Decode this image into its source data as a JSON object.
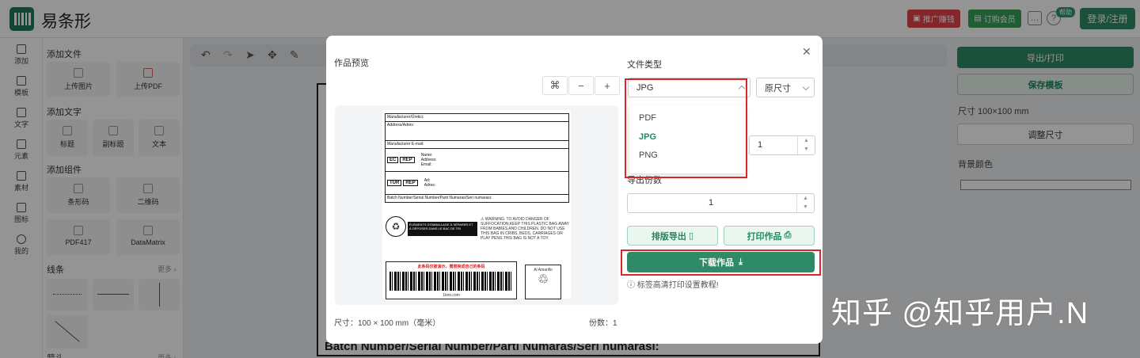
{
  "app": {
    "brand": "易条形"
  },
  "header": {
    "promo_label": "推广赚钱",
    "order_label": "订购会员",
    "help_badge": "帮助",
    "login_label": "登录/注册",
    "colors": {
      "promo": "#e0444a",
      "order": "#3aa05a",
      "login": "#2f8a67"
    }
  },
  "rail": {
    "items": [
      {
        "label": "添加",
        "icon": "plus-icon"
      },
      {
        "label": "模板",
        "icon": "grid-icon"
      },
      {
        "label": "文字",
        "icon": "text-icon"
      },
      {
        "label": "元素",
        "icon": "shapes-icon"
      },
      {
        "label": "素材",
        "icon": "assets-icon"
      },
      {
        "label": "图标",
        "icon": "icons-icon"
      },
      {
        "label": "我的",
        "icon": "user-icon"
      }
    ]
  },
  "panel": {
    "add_file": "添加文件",
    "upload_image": "上传图片",
    "upload_pdf": "上传PDF",
    "add_text": "添加文字",
    "title": "标题",
    "subtitle": "副标题",
    "text": "文本",
    "add_component": "添加组件",
    "barcode": "条形码",
    "qrcode": "二维码",
    "pdf417": "PDF417",
    "datamatrix": "DataMatrix",
    "lines": "线条",
    "more": "更多 ›",
    "arrows": "箭头"
  },
  "canvas": {
    "bottom_text": "Batch Number/Serial Number/Parti Numaras/Seri numarası:"
  },
  "right_panel": {
    "export_print": "导出/打印",
    "save_template": "保存模板",
    "size": "尺寸 100×100 mm",
    "resize": "调整尺寸",
    "bg_color": "背景颜色"
  },
  "modal": {
    "title": "作品预览",
    "close_icon": "close-icon",
    "zoom": {
      "fit": "⌘",
      "minus": "−",
      "plus": "+"
    },
    "file_type_label": "文件类型",
    "file_type_value": "JPG",
    "size_mode_value": "原尺寸",
    "file_type_options": [
      "PDF",
      "JPG",
      "PNG"
    ],
    "selected_option": "JPG",
    "dpi_value": "1",
    "copies_label": "导出份数",
    "copies_value": "1",
    "layout_export": "排版导出",
    "print_work": "打印作品",
    "download": "下载作品",
    "tip": "标签高清打印设置教程!",
    "footer_size": "尺寸：100 × 100 mm（毫米）",
    "footer_copies": "份数：1",
    "accent": "#2f8a67",
    "highlight": "#d9262c"
  },
  "preview": {
    "manufacturer": "Manufacturer/Üretici:",
    "address": "Address/Adres:",
    "email": "Manufacturer E-mail:",
    "ec": "EC",
    "rep": "REP",
    "ec_fields": "Name:\nAddress:\nEmail:",
    "tur": "TUR",
    "tur_fields": "Ad:\nAdres:",
    "batch": "Batch Number/Serial Number/Parti Numaras/Seri numarası:",
    "recycle": "ÉLÉMENTS D'EMBALLAGE À SÉPARER ET À DÉPOSER DANS LE BAC DE TRI",
    "warning": "⚠ WARNING: TO AVOID DANGER OF SUFFOCATION,KEEP THIS PLASTIC BAG AWAY FROM BABIES AND CHILDREN. DO NOT USE THIS BAG IN CRIBS, BEDS, CARRIAGES OR PLAY PENS.THIS BAG IS NOT A TOY.",
    "barcode_red": "此条码仅被演示，需替换成自己的条码",
    "barcode_site": "1txm.com",
    "amarillo": "Al Amarillo"
  },
  "watermark": "知乎 @知乎用户.N"
}
